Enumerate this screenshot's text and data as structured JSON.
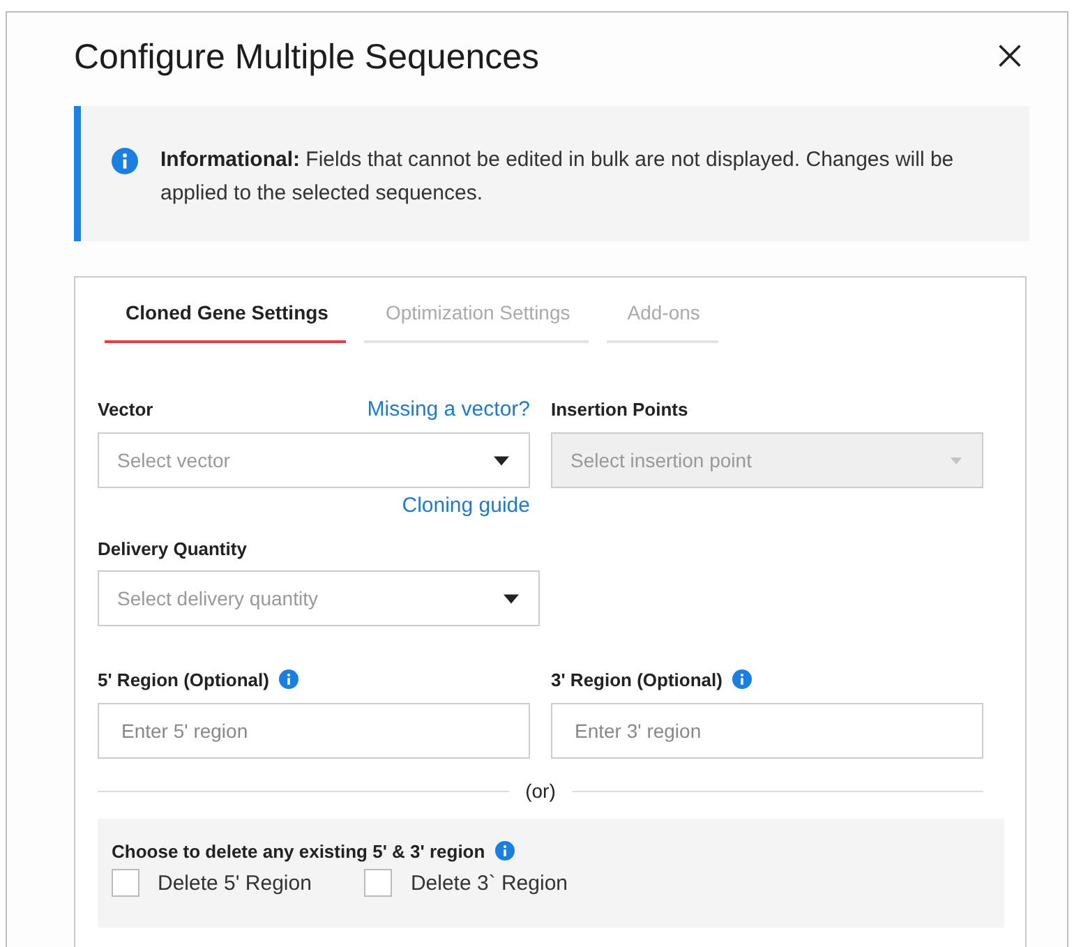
{
  "dialog": {
    "title": "Configure Multiple Sequences"
  },
  "notice": {
    "text": "**Informational:** Fields that cannot be edited in bulk are not displayed. Changes will be applied to the selected sequences."
  },
  "tabs": [
    {
      "label": "Cloned Gene Settings",
      "selected": true
    },
    {
      "label": "Optimization Settings",
      "selected": false
    },
    {
      "label": "Add-ons",
      "selected": false
    }
  ],
  "vector": {
    "label": "Vector",
    "link": "Missing a vector?",
    "placeholder": "Select vector",
    "disabled": false,
    "help_link": "Cloning guide"
  },
  "insertion_points": {
    "label": "Insertion Points",
    "placeholder": "Select insertion point",
    "disabled": true
  },
  "delivery_quantity": {
    "label": "Delivery Quantity",
    "placeholder": "Select delivery quantity",
    "disabled": false
  },
  "regions": [
    {
      "label": "5' Region (Optional)",
      "placeholder": "Enter 5' region"
    },
    {
      "label": "3' Region (Optional)",
      "placeholder": "Enter 3' region"
    }
  ],
  "separator": "(or)",
  "delete_section": {
    "title": "Choose to delete any existing 5' & 3' region",
    "options": [
      {
        "label": "Delete 5' Region",
        "checked": false
      },
      {
        "label": "Delete 3` Region",
        "checked": false
      }
    ]
  }
}
